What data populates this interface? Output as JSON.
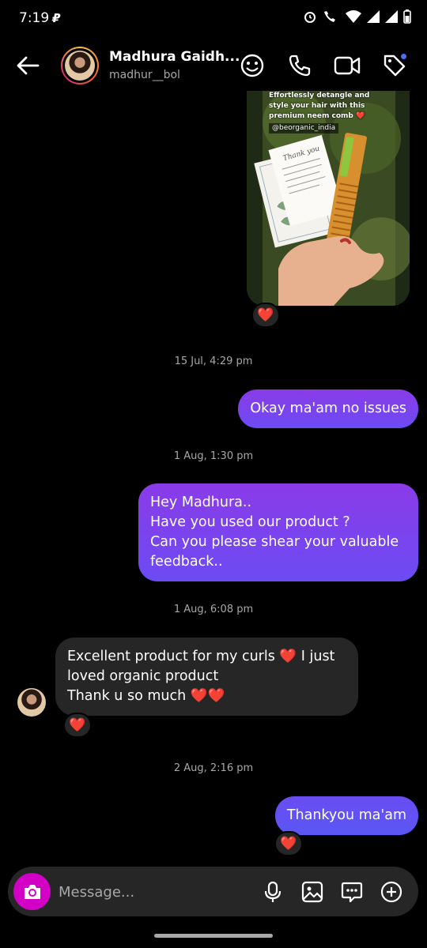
{
  "status_bar": {
    "time": "7:19"
  },
  "header": {
    "name": "Madhura Gaidh...",
    "username": "madhur__bol"
  },
  "shared_post": {
    "caption": "Effortlessly detangle and style your hair with this premium neem comb ❤️",
    "handle": "@beorganic_india",
    "card_text": "Thank you"
  },
  "reaction_emoji": "❤️",
  "messages": [
    {
      "timestamp": "15 Jul, 4:29 pm"
    },
    {
      "direction": "out",
      "lines": [
        "Okay ma'am no issues"
      ]
    },
    {
      "timestamp": "1 Aug, 1:30 pm"
    },
    {
      "direction": "out",
      "lines": [
        "Hey Madhura..",
        "Have you used our product ?",
        "Can you please shear your valuable",
        "feedback.."
      ]
    },
    {
      "timestamp": "1 Aug, 6:08 pm"
    },
    {
      "direction": "in",
      "lines": [
        "Excellent product for my curls ❤️ I just",
        "loved organic product",
        "Thank u so much ❤️❤️"
      ]
    },
    {
      "timestamp": "2 Aug, 2:16 pm"
    },
    {
      "direction": "out",
      "lines": [
        "Thankyou ma'am"
      ]
    }
  ],
  "composer": {
    "placeholder": "Message..."
  },
  "icons": {
    "back": "back-arrow-icon",
    "stickers": "sticker-face-icon",
    "call": "phone-icon",
    "video": "video-camera-icon",
    "tag": "tag-icon",
    "camera": "camera-icon",
    "mic": "microphone-icon",
    "gallery": "gallery-icon",
    "chat": "chat-bubble-icon",
    "plus": "plus-circle-icon"
  },
  "colors": {
    "outgoing_bubble_top": "#8a3be8",
    "outgoing_bubble_bottom": "#6c4bf3",
    "incoming_bubble": "#262626",
    "camera_button": "#d300c5",
    "notification_dot": "#4f6df5"
  }
}
